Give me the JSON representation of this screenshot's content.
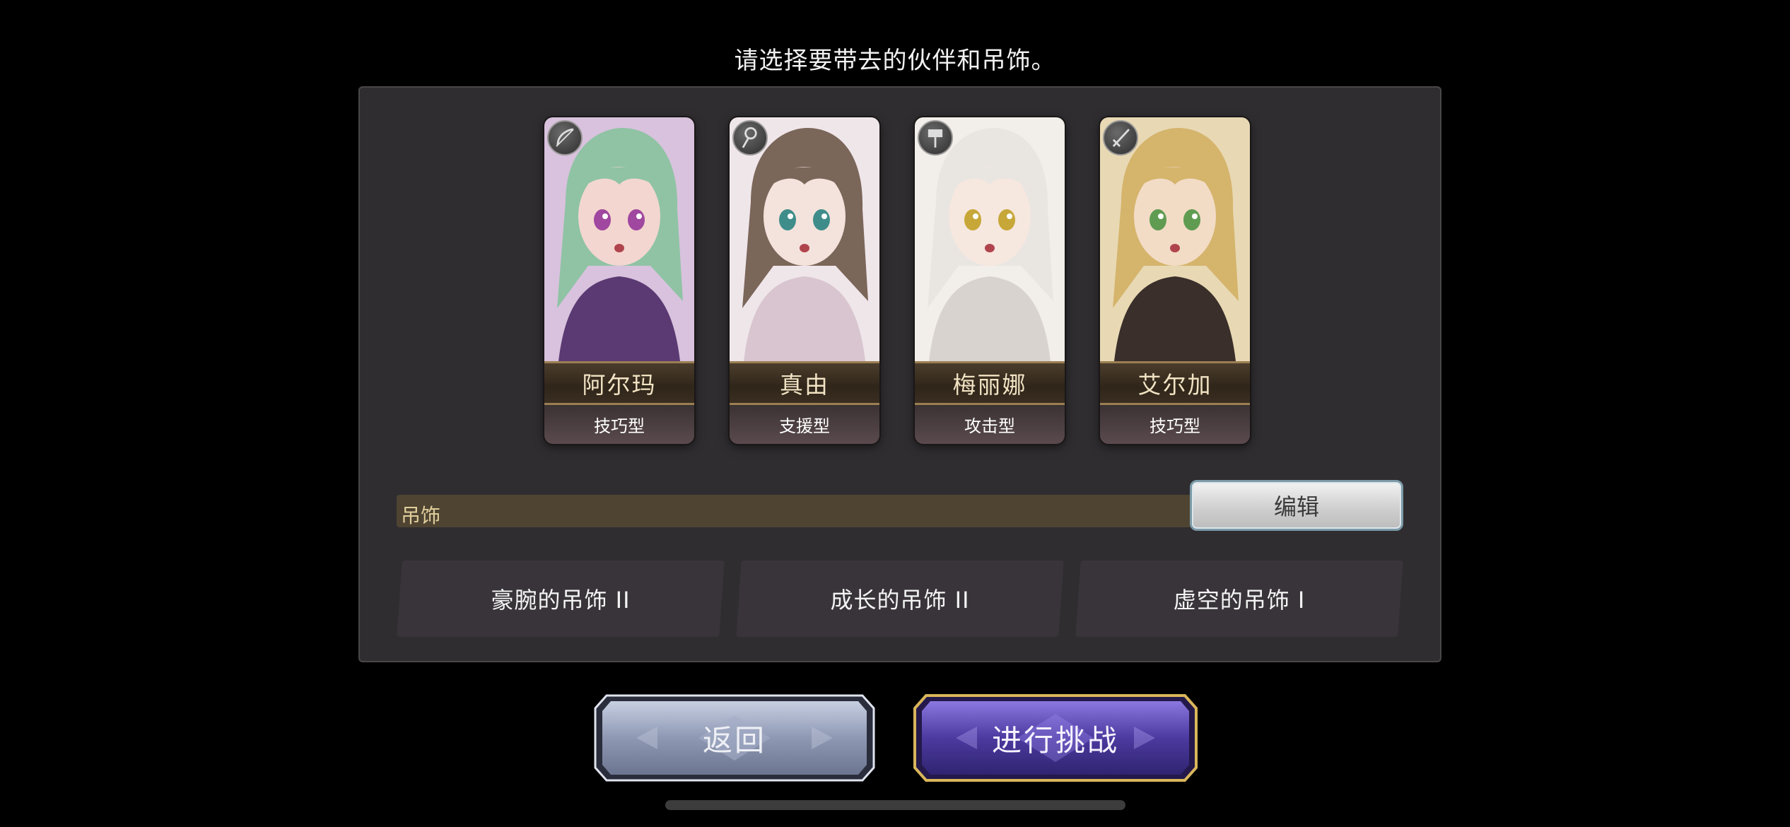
{
  "prompt": "请选择要带去的伙伴和吊饰。",
  "party": [
    {
      "name": "阿尔玛",
      "type": "技巧型",
      "role_icon": "bow-icon",
      "hair": "#8fc3a4",
      "skin": "#f3d6cf",
      "eye": "#a0479f",
      "bg": "#d8c2dd",
      "outfit": "#5b3a73"
    },
    {
      "name": "真由",
      "type": "支援型",
      "role_icon": "staff-icon",
      "hair": "#7b665a",
      "skin": "#f4e3dc",
      "eye": "#3f8d8b",
      "bg": "#efe6ea",
      "outfit": "#d9c5cf"
    },
    {
      "name": "梅丽娜",
      "type": "攻击型",
      "role_icon": "hammer-icon",
      "hair": "#e9e6e2",
      "skin": "#f6e7df",
      "eye": "#c7a738",
      "bg": "#f2eeea",
      "outfit": "#d8d3cf"
    },
    {
      "name": "艾尔加",
      "type": "技巧型",
      "role_icon": "sword-icon",
      "hair": "#d5b46c",
      "skin": "#f2dcc6",
      "eye": "#5f9c52",
      "bg": "#e8d9b4",
      "outfit": "#3a2f2a"
    }
  ],
  "charm": {
    "section_label": "吊饰",
    "edit_label": "编辑",
    "slots": [
      "豪腕的吊饰 II",
      "成长的吊饰 II",
      "虚空的吊饰 I"
    ]
  },
  "buttons": {
    "back_label": "返回",
    "challenge_label": "进行挑战"
  },
  "colors": {
    "panel_bg": "#2f2d30",
    "charm_bar": "#4f4432",
    "challenge_accent": "#5a45b8",
    "gold_border": "#c9a64a"
  }
}
